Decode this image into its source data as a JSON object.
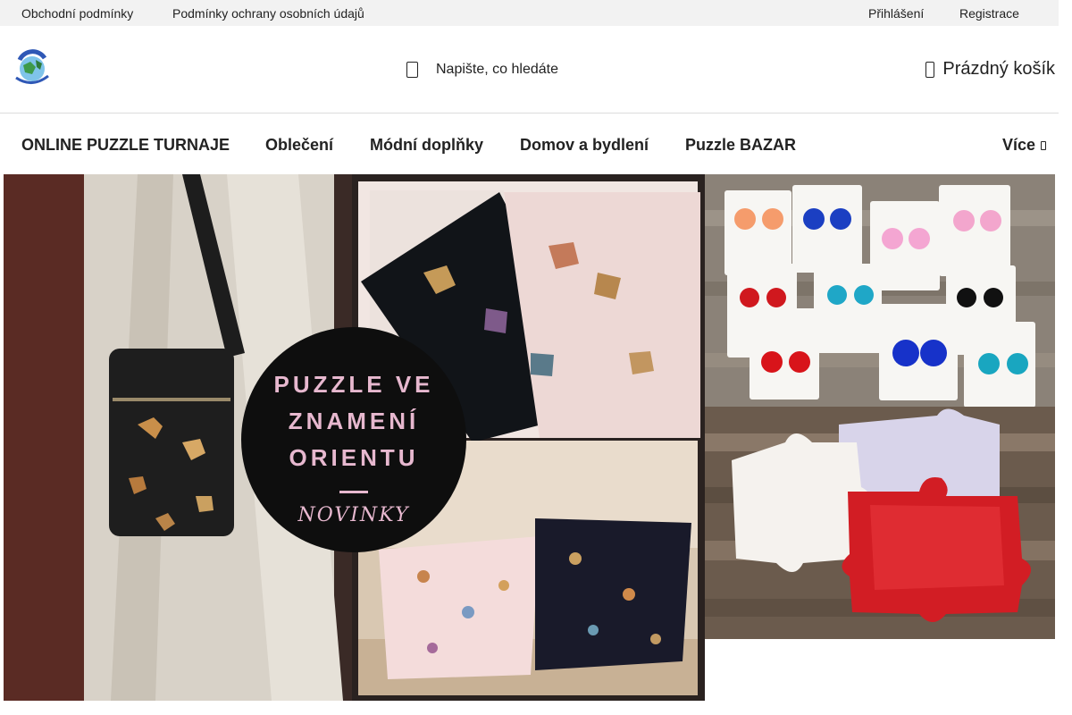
{
  "topbar": {
    "left_links": [
      "Obchodní podmínky",
      "Podmínky ochrany osobních údajů"
    ],
    "login_label": "Přihlášení",
    "register_label": "Registrace"
  },
  "header": {
    "logo_icon": "puzzle-globe-logo",
    "search_placeholder": "Napište, co hledáte",
    "cart_label": "Prázdný košík"
  },
  "nav": {
    "items": [
      "ONLINE PUZZLE TURNAJE",
      "Oblečení",
      "Módní doplňky",
      "Domov a bydlení",
      "Puzzle BAZAR"
    ],
    "more_label": "Více"
  },
  "banners": {
    "main": {
      "title_line1": "PUZZLE VE",
      "title_line2": "ZNAMENÍ",
      "title_line3": "ORIENTU",
      "subtitle": "NOVINKY"
    },
    "side1": {
      "subject": "puzzle earrings on cards"
    },
    "side2": {
      "subject": "puzzle shaped soaps"
    }
  },
  "colors": {
    "topbar_bg": "#f2f2f2",
    "text": "#222222",
    "banner_title": "#e7b8cf"
  }
}
